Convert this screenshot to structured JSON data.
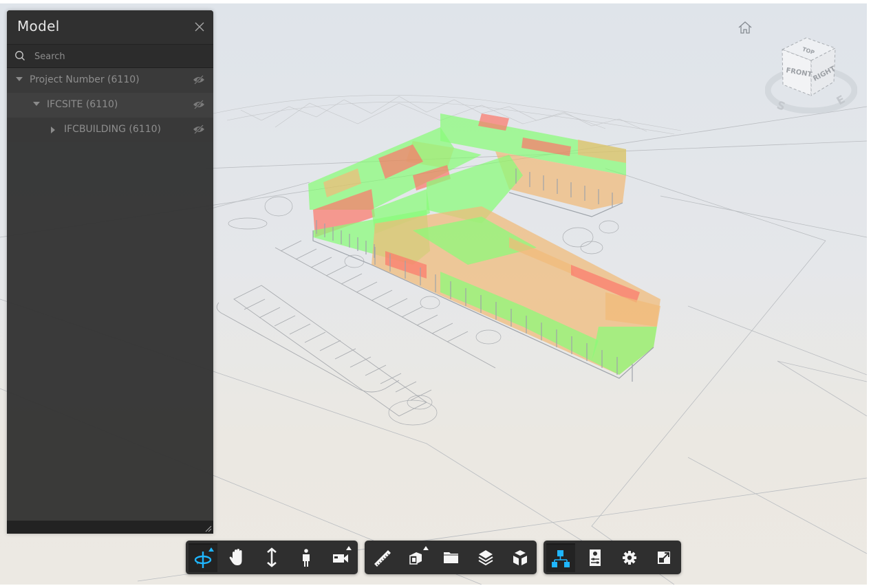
{
  "model_panel": {
    "title": "Model",
    "close_icon": "close-icon",
    "search": {
      "placeholder": "Search",
      "value": ""
    },
    "tree": [
      {
        "label": "Project Number (6110)",
        "expanded": true,
        "level": 0,
        "visibility_icon": "eye-hidden-icon"
      },
      {
        "label": "IFCSITE (6110)",
        "expanded": true,
        "level": 1,
        "visibility_icon": "eye-hidden-icon"
      },
      {
        "label": "IFCBUILDING (6110)",
        "expanded": false,
        "level": 2,
        "visibility_icon": "eye-hidden-icon"
      }
    ]
  },
  "viewcube": {
    "faces": {
      "top": "TOP",
      "front": "FRONT",
      "right": "RIGHT"
    },
    "compass": {
      "south": "S",
      "east": "E"
    }
  },
  "toolbar": {
    "groups": [
      {
        "name": "navigation",
        "tools": [
          {
            "id": "orbit",
            "icon": "orbit-icon",
            "active": true,
            "has_submenu": true
          },
          {
            "id": "pan",
            "icon": "pan-hand-icon",
            "active": false,
            "has_submenu": false
          },
          {
            "id": "zoom",
            "icon": "dolly-zoom-icon",
            "active": false,
            "has_submenu": false
          },
          {
            "id": "first-person",
            "icon": "walk-person-icon",
            "active": false,
            "has_submenu": false
          },
          {
            "id": "camera",
            "icon": "camera-icon",
            "active": false,
            "has_submenu": true
          }
        ]
      },
      {
        "name": "modeling",
        "tools": [
          {
            "id": "measure",
            "icon": "ruler-icon",
            "active": false,
            "has_submenu": false
          },
          {
            "id": "section",
            "icon": "section-box-icon",
            "active": false,
            "has_submenu": true
          },
          {
            "id": "explode",
            "icon": "folder-icon",
            "active": false,
            "has_submenu": false
          },
          {
            "id": "layers",
            "icon": "layers-icon",
            "active": false,
            "has_submenu": false
          },
          {
            "id": "model-browser-cube",
            "icon": "explode-cube-icon",
            "active": false,
            "has_submenu": false
          }
        ]
      },
      {
        "name": "settings",
        "tools": [
          {
            "id": "model-structure",
            "icon": "hierarchy-icon",
            "active": true,
            "has_submenu": false
          },
          {
            "id": "properties",
            "icon": "properties-icon",
            "active": false,
            "has_submenu": false
          },
          {
            "id": "settings",
            "icon": "gear-icon",
            "active": false,
            "has_submenu": false
          },
          {
            "id": "fullscreen",
            "icon": "fullscreen-icon",
            "active": false,
            "has_submenu": false
          }
        ]
      }
    ]
  },
  "colors": {
    "accent": "#1fb6ff",
    "heat_high": "#ff6b5a",
    "heat_mid": "#f3b46a",
    "heat_low": "#7dff6a"
  }
}
